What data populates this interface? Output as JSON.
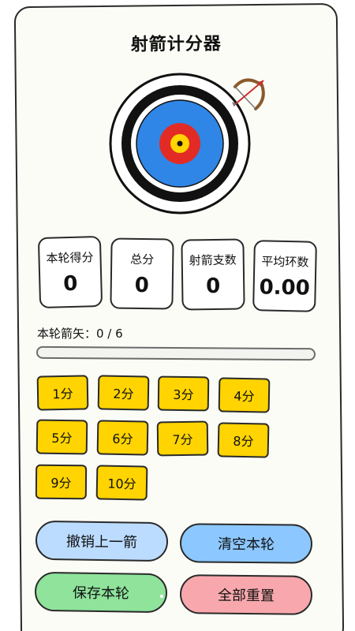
{
  "app": {
    "title": "射箭计分器"
  },
  "target": {
    "icon": "archery-target-icon",
    "ring_colors": [
      "#ffffff",
      "#111111",
      "#2f86e6",
      "#e32b25",
      "#ffd400"
    ],
    "bow_icon": "bow-and-arrow-icon"
  },
  "stats": [
    {
      "label": "本轮得分",
      "value": "0"
    },
    {
      "label": "总分",
      "value": "0"
    },
    {
      "label": "射箭支数",
      "value": "0"
    },
    {
      "label": "平均环数",
      "value": "0.00"
    }
  ],
  "progress": {
    "label": "本轮箭矢：0 / 6",
    "current": 0,
    "total": 6,
    "fraction": 0
  },
  "scores": [
    "1分",
    "2分",
    "3分",
    "4分",
    "5分",
    "6分",
    "7分",
    "8分",
    "9分",
    "10分"
  ],
  "actions": {
    "undo": "撤销上一箭",
    "clear_round": "清空本轮",
    "save_round": "保存本轮",
    "reset_all": "全部重置"
  },
  "colors": {
    "score_button": "#ffd400",
    "undo": "#bcdcff",
    "clear_round": "#8cc8ff",
    "save_round": "#8fe39b",
    "reset_all": "#f8a8ad"
  }
}
